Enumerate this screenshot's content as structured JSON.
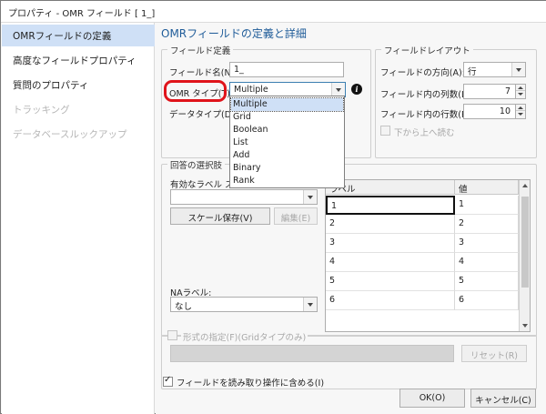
{
  "window": {
    "title": "プロパティ - OMR フィールド [ 1_]"
  },
  "sidebar": {
    "items": [
      {
        "label": "OMRフィールドの定義"
      },
      {
        "label": "高度なフィールドプロパティ"
      },
      {
        "label": "質問のプロパティ"
      },
      {
        "label": "トラッキング"
      },
      {
        "label": "データベースルックアップ"
      }
    ]
  },
  "main": {
    "heading": "OMRフィールドの定義と詳細",
    "field_def": {
      "legend": "フィールド定義",
      "name_label": "フィールド名(N):",
      "name_value": "1_",
      "type_label": "OMR タイプ(T):",
      "type_value": "Multiple",
      "data_type_label": "データタイプ(D):",
      "type_options": [
        "Multiple",
        "Grid",
        "Boolean",
        "List",
        "Add",
        "Binary",
        "Rank"
      ],
      "info_glyph": "i"
    },
    "layout": {
      "legend": "フィールドレイアウト",
      "direction_label": "フィールドの方向(A):",
      "direction_value": "行",
      "cols_label": "フィールド内の列数(L):",
      "cols_value": "7",
      "rows_label": "フィールド内の行数(R):",
      "rows_value": "10",
      "bottom_up_label": "下から上へ読む"
    },
    "choices": {
      "legend": "回答の選択肢",
      "valid_labels_label": "有効なラベル ス",
      "scale_save_button": "スケール保存(V)",
      "edit_button": "編集(E)",
      "na_label": "NAラベル:",
      "na_value": "なし",
      "table": {
        "headers": [
          "ラベル",
          "値"
        ],
        "rows": [
          [
            "1",
            "1"
          ],
          [
            "2",
            "2"
          ],
          [
            "3",
            "3"
          ],
          [
            "4",
            "4"
          ],
          [
            "5",
            "5"
          ],
          [
            "6",
            "6"
          ]
        ]
      }
    },
    "format": {
      "label": "形式の指定(F)(Gridタイプのみ)",
      "reset_button": "リセット(R)"
    },
    "include_checkbox_label": "フィールドを読み取り操作に含める(I)",
    "ok_button": "OK(O)",
    "cancel_button": "キャンセル(C)"
  },
  "colors": {
    "accent": "#1f5c99",
    "highlight_ring": "#e0141b",
    "selection": "#cfe0f6"
  }
}
